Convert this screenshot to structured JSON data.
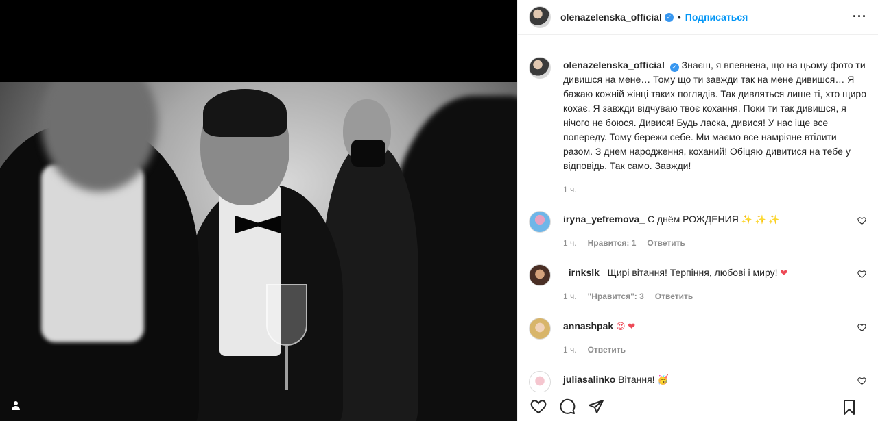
{
  "post": {
    "username": "olenazelenska_official",
    "verified_badge": "verified-badge",
    "follow_label": "Подписаться",
    "more_icon": "more-options-icon"
  },
  "caption": {
    "username": "olenazelenska_official",
    "text": "Знаєш, я впевнена, що на цьому фото ти дивишся на мене… Тому що ти завжди так на мене дивишся… Я бажаю кожній жінці таких поглядів. Так дивляться лише ті, хто щиро кохає. Я завжди відчуваю твоє кохання. Поки ти так дивишся, я нічого не боюся. Дивися! Будь ласка, дивися! У нас іще все попереду. Тому бережи себе. Ми маємо все намріяне втілити разом. З днем народження, коханий! Обіцяю дивитися на тебе у відповідь. Так само. Завжди!",
    "time": "1 ч."
  },
  "comments": [
    {
      "username": "iryna_yefremova_",
      "text": "С днём РОЖДЕНИЯ",
      "emoji": "✨ ✨ ✨",
      "time": "1 ч.",
      "likes": "Нравится: 1",
      "reply": "Ответить"
    },
    {
      "username": "_irnkslk_",
      "text": "Щирі вітання! Терпіння, любові і миру!",
      "emoji": "❤",
      "time": "1 ч.",
      "likes": "\"Нравится\": 3",
      "reply": "Ответить"
    },
    {
      "username": "annashpak",
      "text": "",
      "emoji": "😍 ❤",
      "time": "1 ч.",
      "likes": "",
      "reply": "Ответить"
    },
    {
      "username": "juliasalinko",
      "text": "Вітання!",
      "emoji": "🥳",
      "time": "",
      "likes": "",
      "reply": ""
    }
  ],
  "actions": {
    "like_icon": "heart-icon",
    "comment_icon": "comment-icon",
    "share_icon": "share-icon",
    "save_icon": "bookmark-icon"
  }
}
